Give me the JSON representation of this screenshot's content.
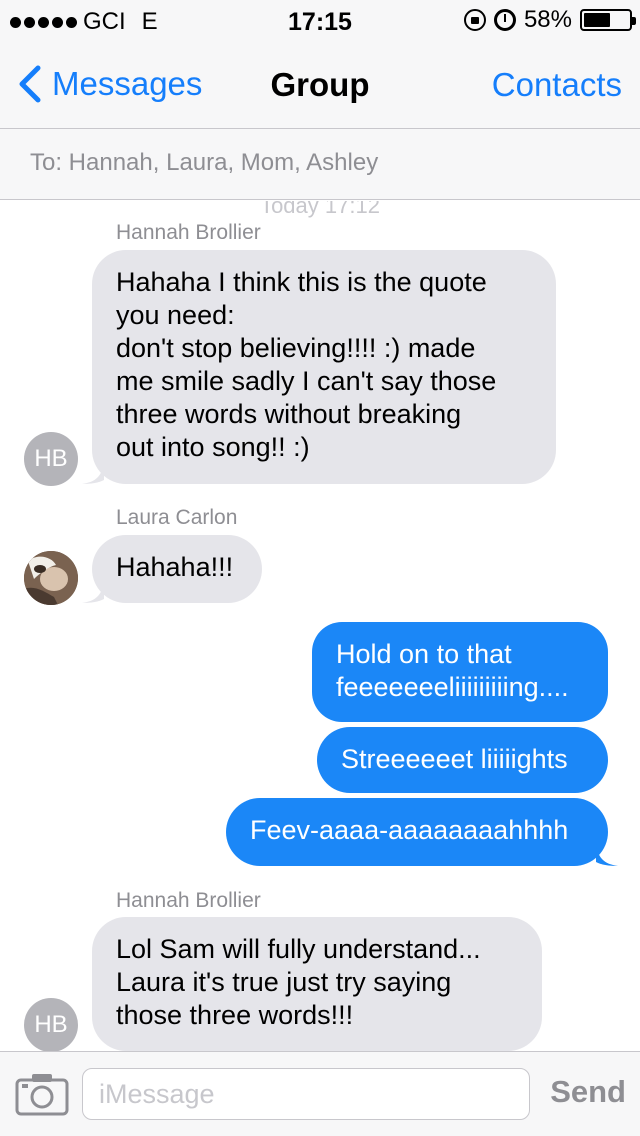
{
  "status_bar": {
    "carrier": "GCI",
    "network": "E",
    "time": "17:15",
    "battery_text": "58%",
    "battery_level": 0.58,
    "signal_dots": 5
  },
  "nav": {
    "back_label": "Messages",
    "title": "Group",
    "contacts_label": "Contacts"
  },
  "recipients": {
    "text": "To: Hannah, Laura, Mom, Ashley"
  },
  "conversation": {
    "faded_header": "Today 17:12",
    "messages": [
      {
        "sender": "Hannah Brollier",
        "direction": "incoming",
        "avatar_initials": "HB",
        "text": "Hahaha I think this is the quote\nyou need:\ndon't stop believing!!!! :) made\nme smile sadly I can't say those\nthree words without breaking\nout into song!! :)"
      },
      {
        "sender": "Laura Carlon",
        "direction": "incoming",
        "avatar": "photo",
        "text": "Hahaha!!!"
      },
      {
        "direction": "outgoing",
        "text": "Hold on to that\nfeeeeeeeliiiiiiiiing...."
      },
      {
        "direction": "outgoing",
        "text": "Streeeeeet liiiiights"
      },
      {
        "direction": "outgoing",
        "text": "Feev-aaaa-aaaaaaaahhhh"
      },
      {
        "sender": "Hannah Brollier",
        "direction": "incoming",
        "avatar_initials": "HB",
        "text": "Lol Sam will fully understand...\nLaura it's true just try saying\nthose three words!!!"
      }
    ]
  },
  "input_bar": {
    "placeholder": "iMessage",
    "send_label": "Send"
  },
  "colors": {
    "accent": "#157efb",
    "outgoing_bubble": "#1b87f7",
    "incoming_bubble": "#e5e5ea",
    "bar_background": "#f7f7f8",
    "secondary_text": "#8e8e93"
  }
}
